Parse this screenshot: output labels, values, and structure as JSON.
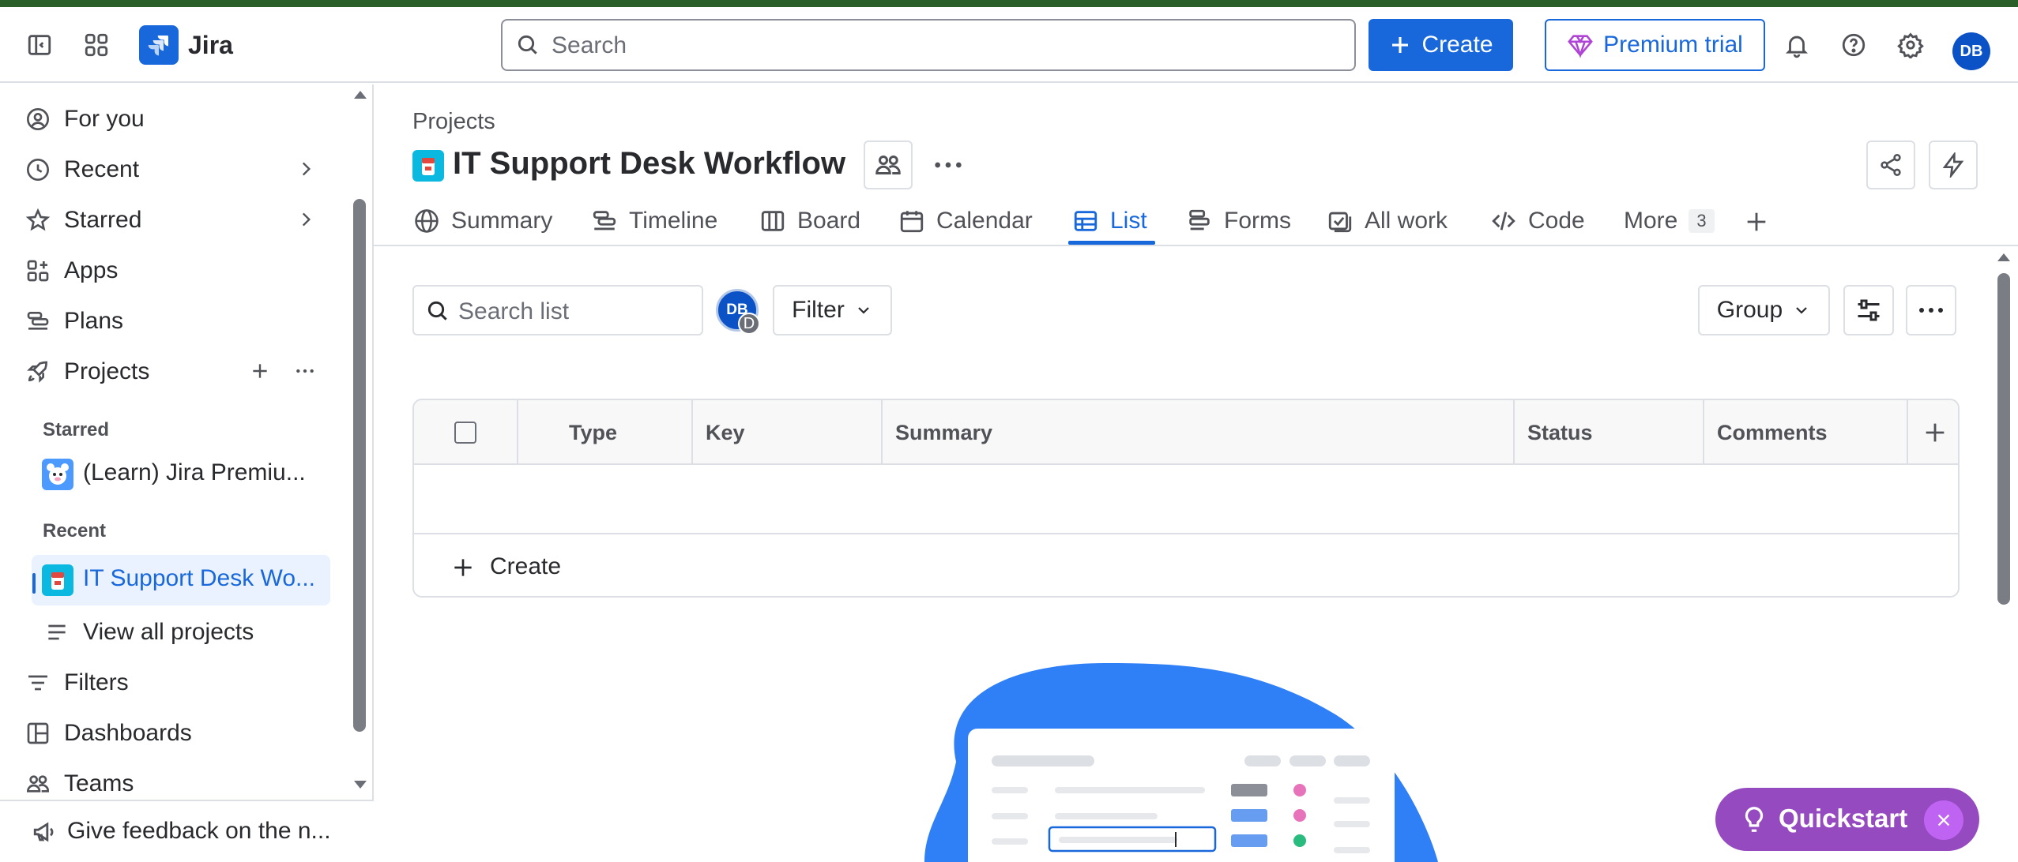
{
  "app": {
    "name": "Jira"
  },
  "topbar": {
    "search_placeholder": "Search",
    "create_label": "Create",
    "premium_label": "Premium trial",
    "avatar_initials": "DB"
  },
  "sidebar": {
    "items": [
      {
        "label": "For you",
        "icon": "user-circle-icon"
      },
      {
        "label": "Recent",
        "icon": "clock-icon"
      },
      {
        "label": "Starred",
        "icon": "star-icon"
      },
      {
        "label": "Apps",
        "icon": "apps-icon"
      },
      {
        "label": "Plans",
        "icon": "plans-icon"
      },
      {
        "label": "Projects",
        "icon": "rocket-icon"
      }
    ],
    "starred_heading": "Starred",
    "starred_project": "(Learn) Jira Premiu...",
    "recent_heading": "Recent",
    "recent_project": "IT Support Desk Wo...",
    "view_all": "View all projects",
    "bottom_items": [
      {
        "label": "Filters",
        "icon": "filter-icon"
      },
      {
        "label": "Dashboards",
        "icon": "dashboard-icon"
      },
      {
        "label": "Teams",
        "icon": "teams-icon"
      }
    ],
    "feedback": "Give feedback on the n..."
  },
  "project": {
    "breadcrumb": "Projects",
    "title": "IT Support Desk Workflow"
  },
  "tabs": [
    {
      "label": "Summary",
      "icon": "globe-icon"
    },
    {
      "label": "Timeline",
      "icon": "timeline-icon"
    },
    {
      "label": "Board",
      "icon": "board-icon"
    },
    {
      "label": "Calendar",
      "icon": "calendar-icon"
    },
    {
      "label": "List",
      "icon": "list-icon",
      "active": true
    },
    {
      "label": "Forms",
      "icon": "forms-icon"
    },
    {
      "label": "All work",
      "icon": "all-work-icon"
    },
    {
      "label": "Code",
      "icon": "code-icon"
    },
    {
      "label": "More",
      "count": "3"
    }
  ],
  "list": {
    "search_placeholder": "Search list",
    "avatar_initials": "DB",
    "avatar_sub": "D",
    "filter_label": "Filter",
    "group_label": "Group",
    "columns": [
      "Type",
      "Key",
      "Summary",
      "Status",
      "Comments"
    ],
    "create_label": "Create"
  },
  "quickstart": {
    "label": "Quickstart"
  },
  "colors": {
    "accent": "#1868db",
    "quickstart": "#964ac0",
    "project_icon": "#0ab8e0"
  }
}
